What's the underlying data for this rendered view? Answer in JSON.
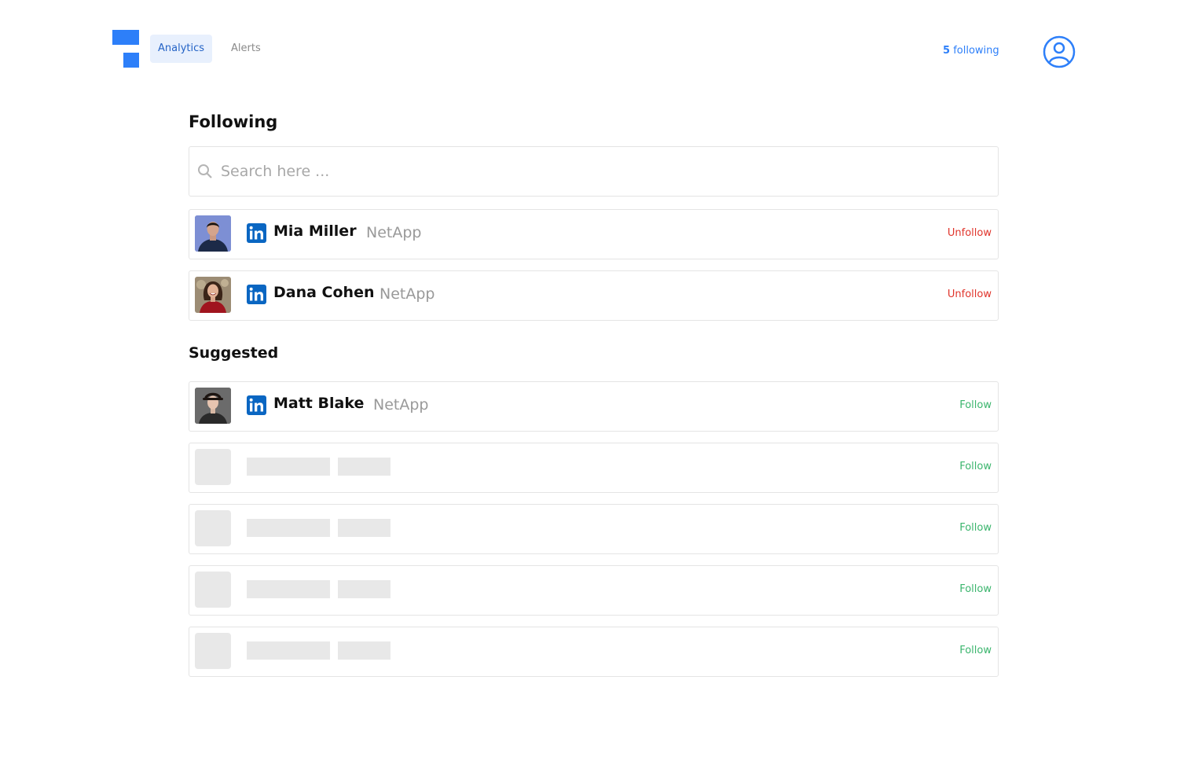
{
  "header": {
    "tabs": [
      {
        "label": "Analytics",
        "active": true
      },
      {
        "label": "Alerts",
        "active": false
      }
    ],
    "following_count": "5",
    "following_label": "following",
    "user_icon": "user-circle-icon"
  },
  "following": {
    "title": "Following",
    "search_placeholder": "Search here ...",
    "people": [
      {
        "name": "Mia Miller",
        "company": "NetApp",
        "action": "Unfollow"
      },
      {
        "name": "Dana Cohen",
        "company": "NetApp",
        "action": "Unfollow"
      }
    ]
  },
  "suggested": {
    "title": "Suggested",
    "people": [
      {
        "name": "Matt Blake",
        "company": "NetApp",
        "action": "Follow"
      }
    ],
    "placeholder_actions": [
      "Follow",
      "Follow",
      "Follow",
      "Follow"
    ]
  },
  "colors": {
    "accent": "#2d7ff9",
    "unfollow": "#e0342b",
    "follow": "#3bb56d",
    "linkedin": "#0a66c2"
  }
}
